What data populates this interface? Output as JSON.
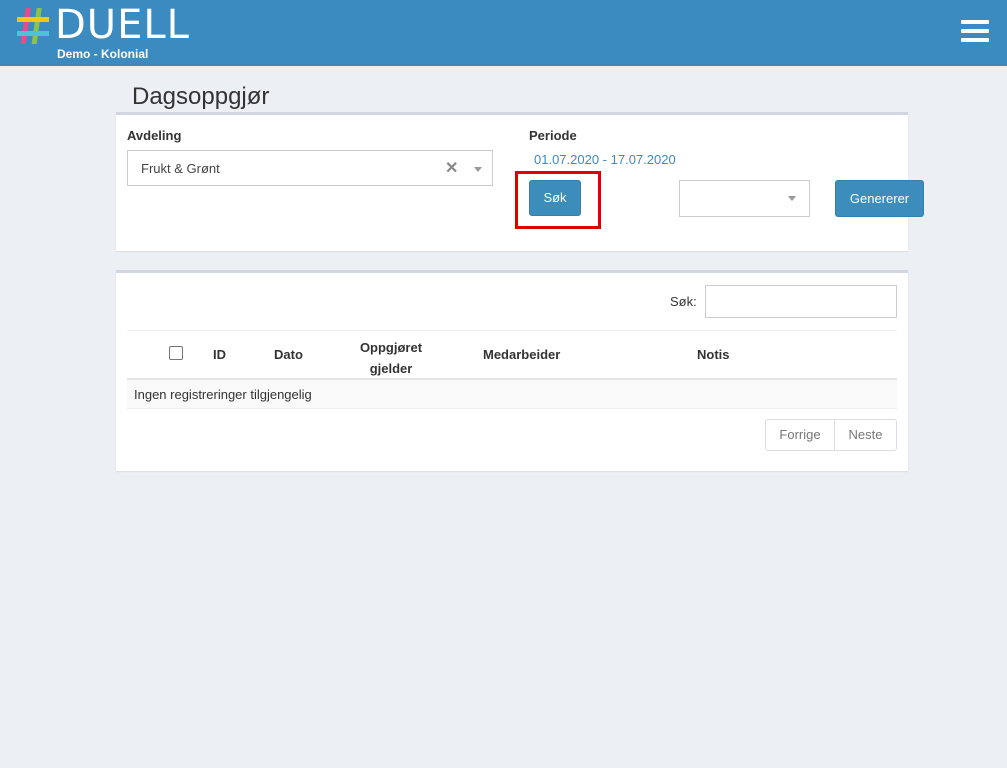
{
  "header": {
    "brand": "DUELL",
    "subtitle": "Demo - Kolonial",
    "logo_colors": [
      "#e84a8a",
      "#f5c518",
      "#4cc3d9",
      "#8bc34a"
    ]
  },
  "page": {
    "title": "Dagsoppgjør"
  },
  "filters": {
    "department_label": "Avdeling",
    "department_value": "Frukt & Grønt",
    "period_label": "Periode",
    "period_value": "01.07.2020 - 17.07.2020",
    "search_button": "Søk",
    "generate_button": "Genererer"
  },
  "table": {
    "search_label": "Søk:",
    "columns": [
      "ID",
      "Dato",
      "Oppgjøret gjelder",
      "Medarbeider",
      "Notis"
    ],
    "empty_message": "Ingen registreringer tilgjengelig",
    "prev_label": "Forrige",
    "next_label": "Neste"
  },
  "colors": {
    "topbar": "#3b8bc0",
    "primary": "#3c8dbc",
    "highlight": "#e00000"
  }
}
